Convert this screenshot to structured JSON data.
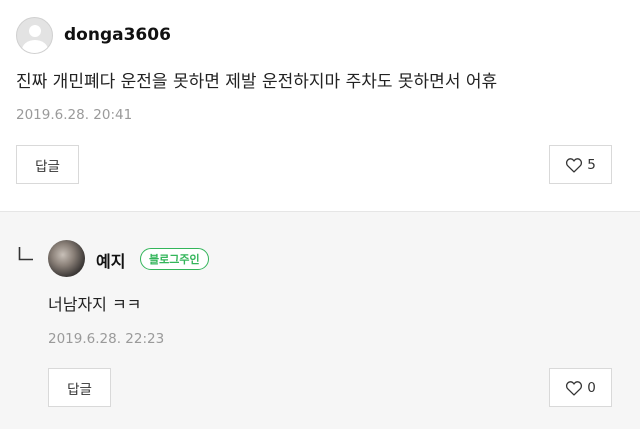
{
  "comment": {
    "username": "donga3606",
    "avatar_icon": "default-user-avatar-icon",
    "text": "진짜 개민폐다 운전을 못하면 제발 운전하지마 주차도 못하면서 어휴",
    "timestamp": "2019.6.28. 20:41",
    "reply_label": "답글",
    "like_count": "5"
  },
  "reply": {
    "arrow_icon": "reply-arrow-icon",
    "username": "예지",
    "avatar_icon": "user-photo-avatar",
    "badge": "블로그주인",
    "text": "너남자지 ㅋㅋ",
    "timestamp": "2019.6.28. 22:23",
    "reply_label": "답글",
    "like_count": "0"
  },
  "colors": {
    "badge_green": "#33b55a",
    "reply_background": "#f6f6f6",
    "timestamp_gray": "#9a9a9a"
  }
}
